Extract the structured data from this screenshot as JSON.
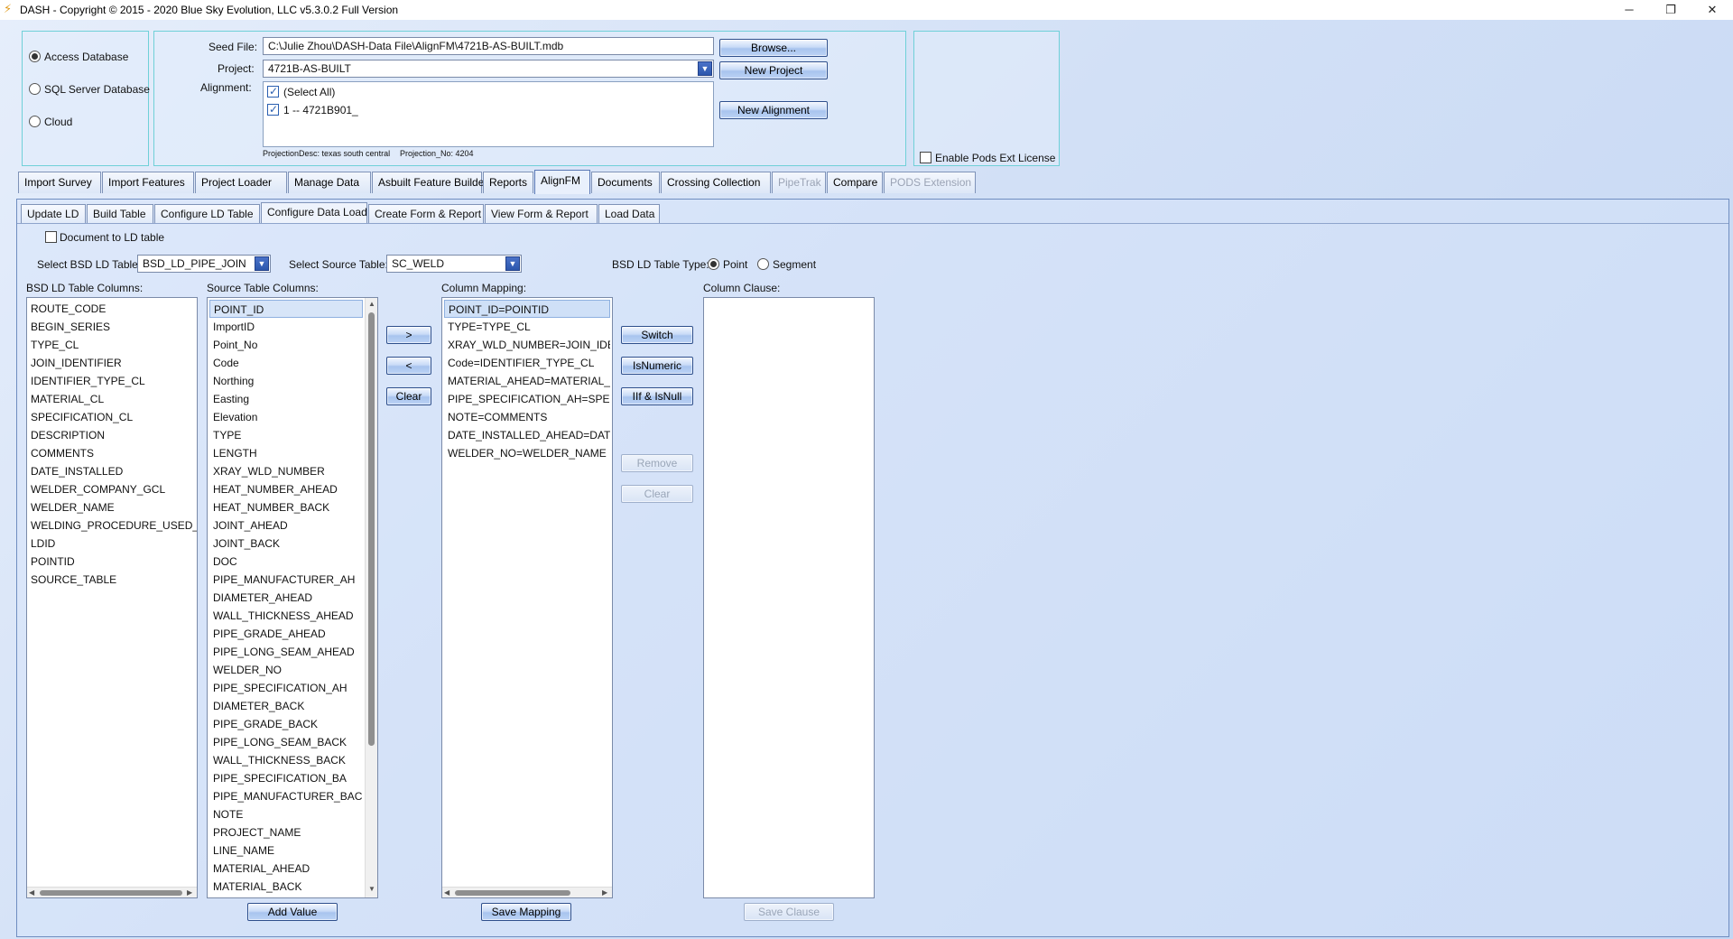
{
  "window": {
    "title": "DASH - Copyright © 2015 - 2020  Blue Sky Evolution, LLC v5.3.0.2 Full Version",
    "minimize": "─",
    "maximize": "❐",
    "close": "✕"
  },
  "db": {
    "options": [
      {
        "label": "Access Database",
        "selected": true
      },
      {
        "label": "SQL Server Database",
        "selected": false
      },
      {
        "label": "Cloud",
        "selected": false
      }
    ]
  },
  "seed": {
    "seed_label": "Seed File:",
    "seed_value": "C:\\Julie Zhou\\DASH-Data File\\AlignFM\\4721B-AS-BUILT.mdb",
    "project_label": "Project:",
    "project_value": "4721B-AS-BUILT",
    "alignment_label": "Alignment:",
    "alignments": [
      {
        "label": "(Select All)",
        "checked": true
      },
      {
        "label": "1 -- 4721B901_",
        "checked": true
      }
    ],
    "projection_desc": "ProjectionDesc: texas south central",
    "projection_no": "Projection_No: 4204",
    "browse": "Browse...",
    "new_project": "New Project",
    "new_alignment": "New Alignment"
  },
  "pods": {
    "label": "Enable Pods Ext License"
  },
  "main_tabs": [
    {
      "label": "Import Survey",
      "state": "normal"
    },
    {
      "label": "Import Features",
      "state": "normal"
    },
    {
      "label": "Project Loader",
      "state": "normal"
    },
    {
      "label": "Manage Data",
      "state": "normal"
    },
    {
      "label": "Asbuilt Feature Builder",
      "state": "normal"
    },
    {
      "label": "Reports",
      "state": "normal"
    },
    {
      "label": "AlignFM",
      "state": "active"
    },
    {
      "label": "Documents",
      "state": "normal"
    },
    {
      "label": "Crossing Collection",
      "state": "normal"
    },
    {
      "label": "PipeTrak",
      "state": "disabled"
    },
    {
      "label": "Compare",
      "state": "normal"
    },
    {
      "label": "PODS Extension",
      "state": "disabled"
    }
  ],
  "sub_tabs": [
    {
      "label": "Update LD",
      "state": "normal"
    },
    {
      "label": "Build Table",
      "state": "normal"
    },
    {
      "label": "Configure LD Table",
      "state": "normal"
    },
    {
      "label": "Configure Data Load",
      "state": "active"
    },
    {
      "label": "Create Form & Report",
      "state": "normal"
    },
    {
      "label": "View Form & Report",
      "state": "normal"
    },
    {
      "label": "Load Data",
      "state": "normal"
    }
  ],
  "config": {
    "doc_to_ld": "Document to LD table",
    "select_bsd_label": "Select BSD LD Table:",
    "select_bsd_value": "BSD_LD_PIPE_JOIN",
    "select_source_label": "Select Source Table:",
    "select_source_value": "SC_WELD",
    "table_type_label": "BSD LD Table Type:",
    "type_point": "Point",
    "type_segment": "Segment",
    "bsd_cols_label": "BSD LD Table Columns:",
    "source_cols_label": "Source Table Columns:",
    "mapping_label": "Column Mapping:",
    "clause_label": "Column Clause:",
    "bsd_columns": [
      "ROUTE_CODE",
      "BEGIN_SERIES",
      "TYPE_CL",
      "JOIN_IDENTIFIER",
      "IDENTIFIER_TYPE_CL",
      "MATERIAL_CL",
      "SPECIFICATION_CL",
      "DESCRIPTION",
      "COMMENTS",
      "DATE_INSTALLED",
      "WELDER_COMPANY_GCL",
      "WELDER_NAME",
      "WELDING_PROCEDURE_USED_GCL",
      "LDID",
      "POINTID",
      "SOURCE_TABLE"
    ],
    "source_columns": [
      "POINT_ID",
      "ImportID",
      "Point_No",
      "Code",
      "Northing",
      "Easting",
      "Elevation",
      "TYPE",
      "LENGTH",
      "XRAY_WLD_NUMBER",
      "HEAT_NUMBER_AHEAD",
      "HEAT_NUMBER_BACK",
      "JOINT_AHEAD",
      "JOINT_BACK",
      "DOC",
      "PIPE_MANUFACTURER_AH",
      "DIAMETER_AHEAD",
      "WALL_THICKNESS_AHEAD",
      "PIPE_GRADE_AHEAD",
      "PIPE_LONG_SEAM_AHEAD",
      "WELDER_NO",
      "PIPE_SPECIFICATION_AH",
      "DIAMETER_BACK",
      "PIPE_GRADE_BACK",
      "PIPE_LONG_SEAM_BACK",
      "WALL_THICKNESS_BACK",
      "PIPE_SPECIFICATION_BA",
      "PIPE_MANUFACTURER_BAC",
      "NOTE",
      "PROJECT_NAME",
      "LINE_NAME",
      "MATERIAL_AHEAD",
      "MATERIAL_BACK"
    ],
    "mappings": [
      "POINT_ID=POINTID",
      "TYPE=TYPE_CL",
      "XRAY_WLD_NUMBER=JOIN_IDENTIFIER",
      "Code=IDENTIFIER_TYPE_CL",
      "MATERIAL_AHEAD=MATERIAL_CL",
      "PIPE_SPECIFICATION_AH=SPECIFICATION_CL",
      "NOTE=COMMENTS",
      "DATE_INSTALLED_AHEAD=DATE_INSTALLED",
      "WELDER_NO=WELDER_NAME"
    ],
    "btn_add": ">",
    "btn_remove_map": "<",
    "btn_clear_left": "Clear",
    "btn_switch": "Switch",
    "btn_isnumeric": "IsNumeric",
    "btn_iif": "IIf & IsNull",
    "btn_remove": "Remove",
    "btn_clear_right": "Clear",
    "btn_add_value": "Add Value",
    "btn_save_mapping": "Save Mapping",
    "btn_save_clause": "Save Clause"
  }
}
